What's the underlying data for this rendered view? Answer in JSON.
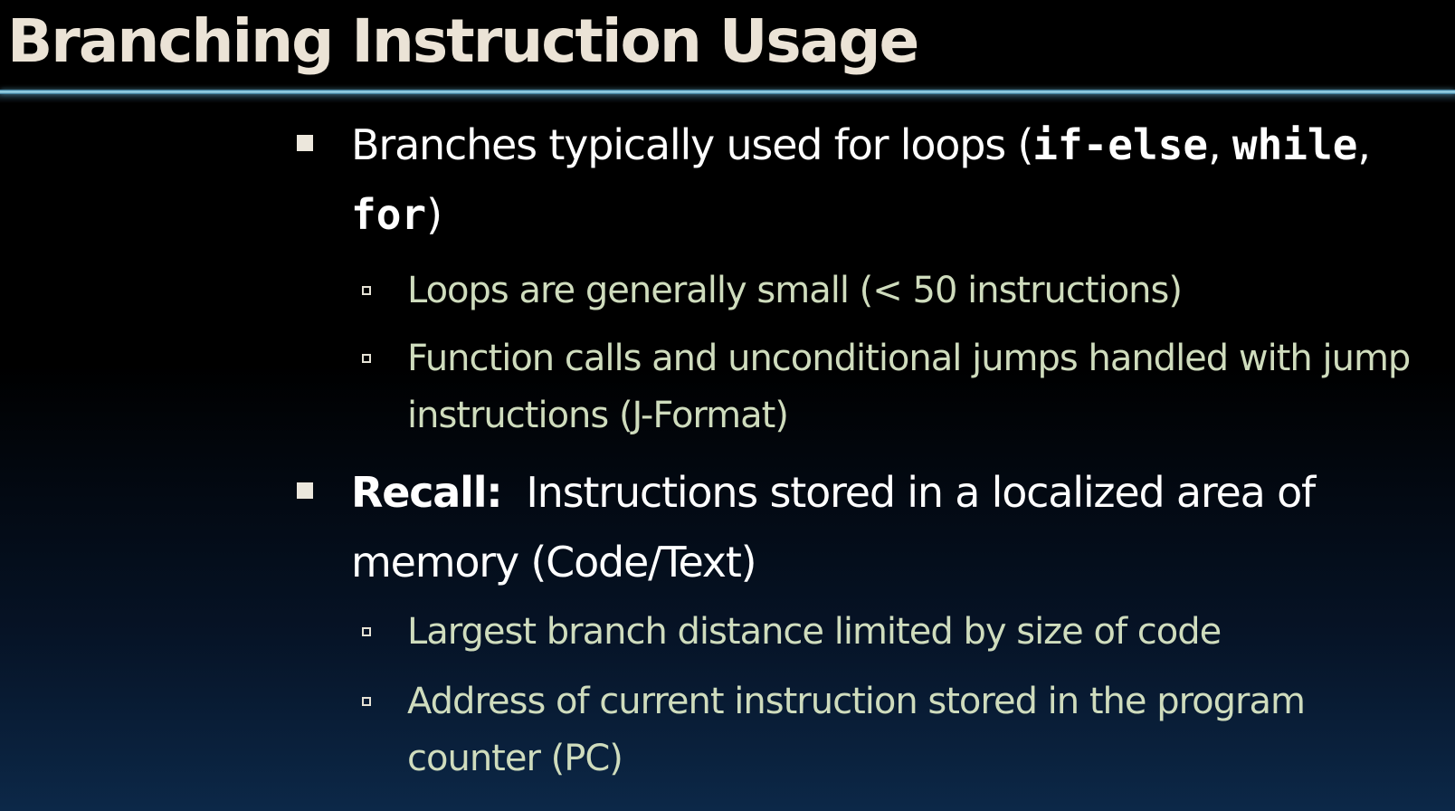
{
  "slide": {
    "title": "Branching Instruction Usage",
    "bullets": [
      {
        "parts": {
          "a": "Branches typically used for loops (",
          "b": "if-else",
          "c": ", ",
          "d": "while",
          "e": ", ",
          "f": "for",
          "g": ")"
        },
        "sub": [
          "Loops are generally small (< 50 instructions)",
          "Function calls and unconditional jumps handled with jump instructions (J-Format)"
        ]
      },
      {
        "parts": {
          "lead": "Recall:",
          "rest": "  Instructions stored in a localized area of memory (Code/Text)"
        },
        "sub": [
          "Largest branch distance limited by size of code",
          "Address of current instruction stored in the program counter (PC)"
        ]
      }
    ]
  },
  "colors": {
    "title": "#ebe3d6",
    "rule": "#a8e4f6",
    "level1_text": "#ffffff",
    "level2_text": "#cfdcbd",
    "background_top": "#000000",
    "background_bottom": "#0c2848"
  }
}
